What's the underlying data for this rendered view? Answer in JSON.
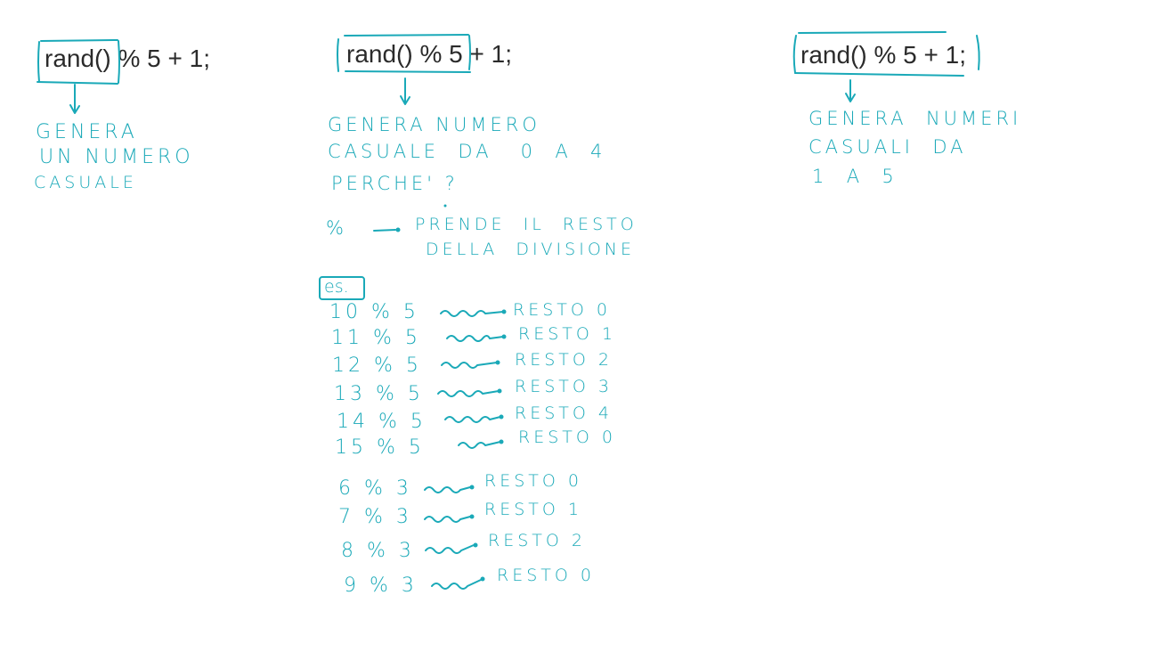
{
  "ink_color": "#1aa9b8",
  "text_color": "#2b2b2b",
  "left": {
    "code": "rand() % 5 + 1;",
    "note": [
      "GENERA",
      "UN NUMERO",
      "CASUALE"
    ]
  },
  "middle": {
    "code": "rand() % 5 + 1;",
    "note": [
      "GENERA NUMERO",
      "CASUALE  DA   0  A  4",
      "PERCHE' ?"
    ],
    "mod_label": "%",
    "mod_explanation": [
      "PRENDE  IL  RESTO",
      "DELLA  DIVISIONE"
    ],
    "es_label": "es.",
    "examples_5": [
      {
        "expr": "10 % 5",
        "result": "RESTO 0"
      },
      {
        "expr": "11 % 5",
        "result": "RESTO 1"
      },
      {
        "expr": "12 % 5",
        "result": "RESTO 2"
      },
      {
        "expr": "13 % 5",
        "result": "RESTO 3"
      },
      {
        "expr": "14 % 5",
        "result": "RESTO 4"
      },
      {
        "expr": "15 % 5",
        "result": "RESTO 0"
      }
    ],
    "examples_3": [
      {
        "expr": "6 % 3",
        "result": "RESTO 0"
      },
      {
        "expr": "7 % 3",
        "result": "RESTO 1"
      },
      {
        "expr": "8 % 3",
        "result": "RESTO 2"
      },
      {
        "expr": "9 % 3",
        "result": "RESTO 0"
      }
    ]
  },
  "right": {
    "code": "rand() % 5 + 1;",
    "note": [
      "GENERA  NUMERI",
      "CASUALI  DA",
      "1  A  5"
    ]
  }
}
